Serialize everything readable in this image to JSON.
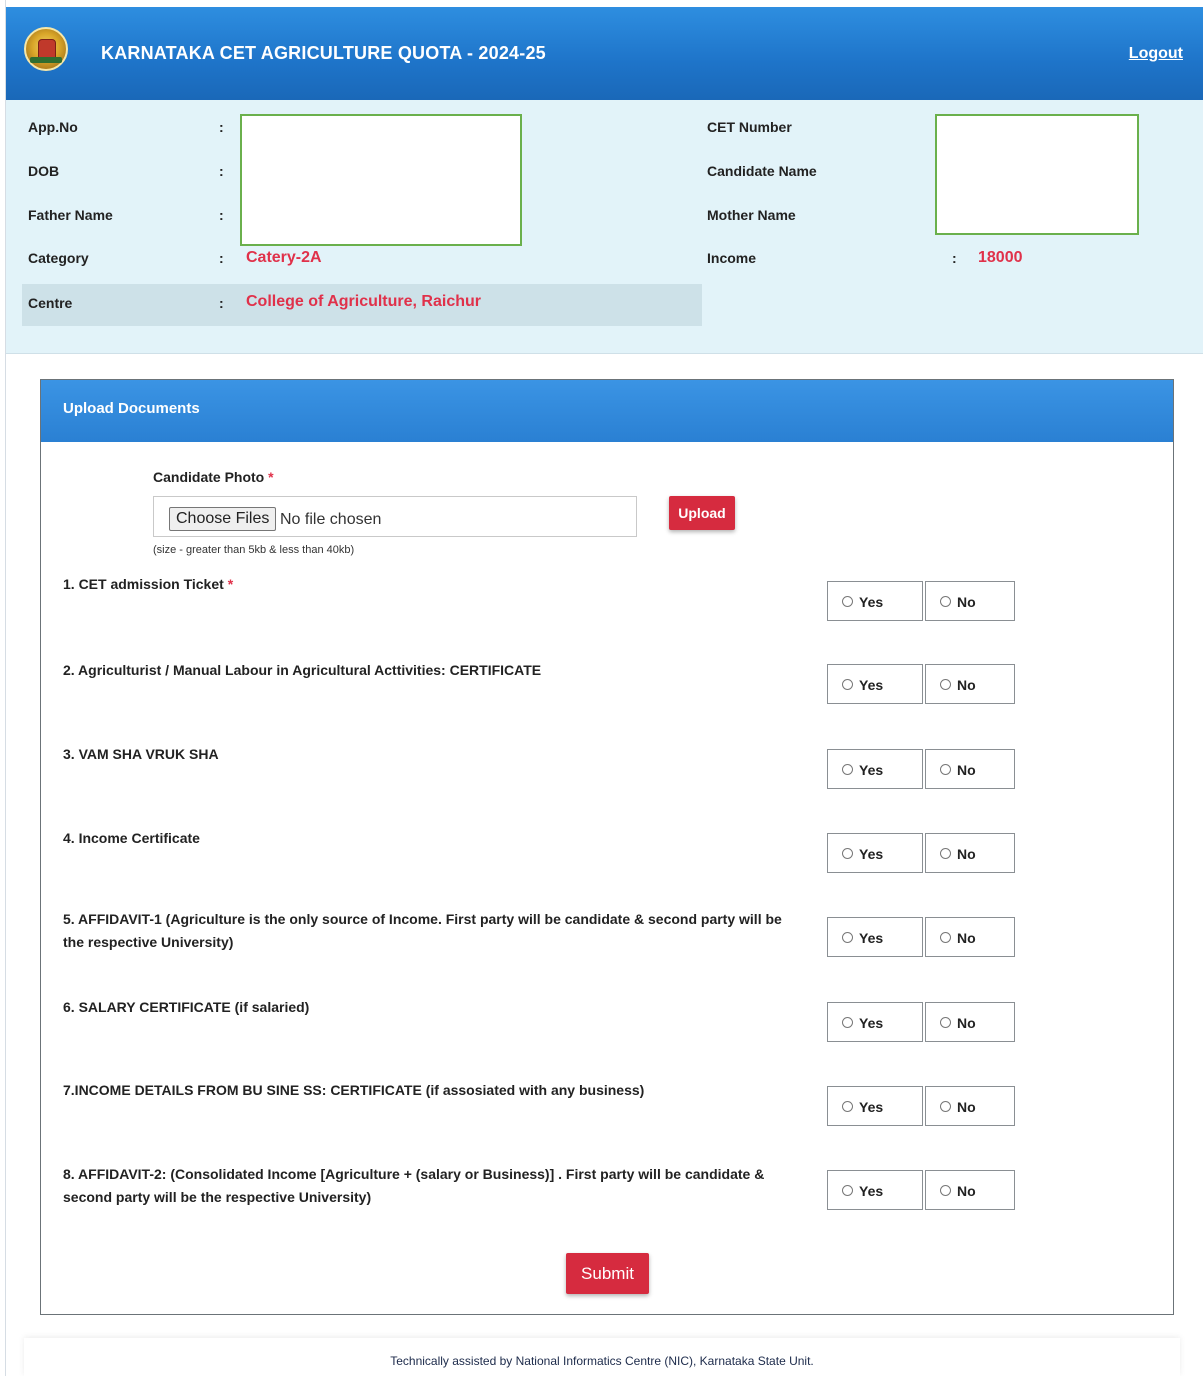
{
  "header": {
    "title": "KARNATAKA CET AGRICULTURE QUOTA - 2024-25",
    "logout": "Logout"
  },
  "info": {
    "app_no_label": "App.No",
    "dob_label": "DOB",
    "father_label": "Father Name",
    "category_label": "Category",
    "category_value": "Catery-2A",
    "centre_label": "Centre",
    "centre_value": "College of Agriculture, Raichur",
    "cet_label": "CET Number",
    "candidate_label": "Candidate Name",
    "mother_label": "Mother Name",
    "income_label": "Income",
    "income_value": "18000",
    "colon": ":"
  },
  "upload": {
    "panel_title": "Upload Documents",
    "photo_label": "Candidate Photo",
    "required_mark": "*",
    "choose_label": "Choose Files",
    "no_file": "No file chosen",
    "upload_label": "Upload",
    "size_hint": "(size - greater than 5kb & less than 40kb)"
  },
  "documents": [
    {
      "label": "1. CET admission Ticket",
      "required": true
    },
    {
      "label": "2. Agriculturist / Manual Labour in Agricultural Acttivities: CERTIFICATE",
      "required": false
    },
    {
      "label": "3. VAM SHA VRUK SHA",
      "required": false
    },
    {
      "label": "4. Income Certificate",
      "required": false
    },
    {
      "label": "5. AFFIDAVIT-1 (Agriculture is the only source of Income. First party will be candidate & second party will be the respective University)",
      "required": false
    },
    {
      "label": "6.  SALARY CERTIFICATE (if salaried)",
      "required": false
    },
    {
      "label": "7.INCOME DETAILS FROM BU SINE SS: CERTIFICATE (if assosiated with any business)",
      "required": false
    },
    {
      "label": "8. AFFIDAVIT-2: (Consolidated Income [Agriculture + (salary or Business)] . First party will be candidate & second party will be the respective University)",
      "required": false
    }
  ],
  "radio": {
    "yes": "Yes",
    "no": "No"
  },
  "submit_label": "Submit",
  "footer_text": "Technically assisted by National Informatics Centre (NIC), Karnataka State Unit.",
  "colors": {
    "accent_red": "#d62b3f",
    "header_blue": "#1e74c9",
    "info_bg": "#e2f3f9"
  }
}
